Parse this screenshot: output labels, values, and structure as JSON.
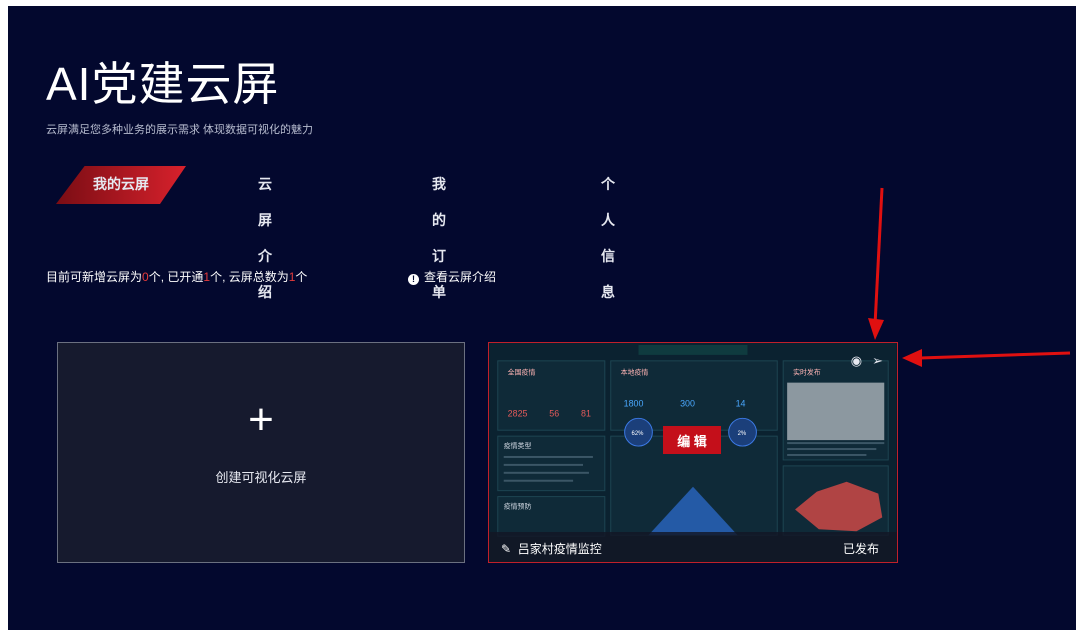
{
  "page": {
    "title": "AI党建云屏",
    "subtitle": "云屏满足您多种业务的展示需求 体现数据可视化的魅力"
  },
  "tabs": [
    {
      "label": "我的云屏",
      "active": true
    },
    {
      "label": "云屏介绍",
      "active": false
    },
    {
      "label": "我的订单",
      "active": false
    },
    {
      "label": "个人信息",
      "active": false
    }
  ],
  "status": {
    "prefix": "目前可新增云屏为",
    "available": "0",
    "mid1": "个,  已开通",
    "opened": "1",
    "mid2": "个,  云屏总数为",
    "total": "1",
    "suffix": "个",
    "link_label": "查看云屏介绍"
  },
  "create_card": {
    "plus": "+",
    "label": "创建可视化云屏"
  },
  "screen_card": {
    "name": "吕家村疫情监控",
    "status": "已发布",
    "edit_label": "编 辑",
    "thumb_texts": {
      "t1": "全国疫情",
      "t2": "本地疫情",
      "t3": "实时发布",
      "n1": "2825",
      "n2": "56",
      "n3": "81",
      "n4": "1800",
      "n5": "300",
      "n6": "14",
      "p1": "62%",
      "p2": "2%",
      "s1": "疫情类型",
      "s2": "疫情预防"
    }
  },
  "icons": {
    "preview": "eye-icon",
    "publish": "send-icon",
    "edit": "pencil-icon",
    "info": "info-icon"
  },
  "colors": {
    "background": "#03082e",
    "accent": "#d8212c",
    "highlight": "#e53b3b"
  }
}
